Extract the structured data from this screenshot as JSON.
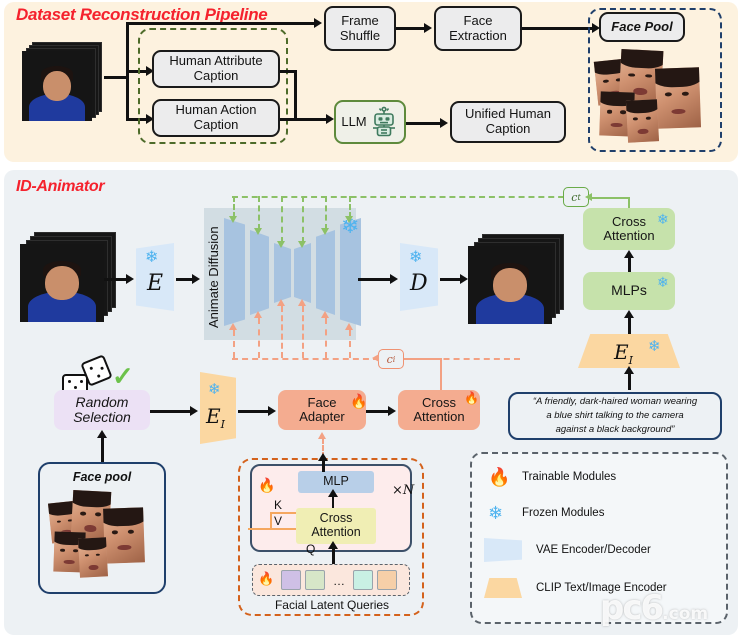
{
  "figure": {
    "panels": [
      {
        "title": "Dataset Reconstruction Pipeline"
      },
      {
        "title": "ID-Animator"
      }
    ]
  },
  "top_panel": {
    "title": "Dataset Reconstruction Pipeline",
    "boxes": {
      "frame_shuffle": "Frame\nShuffle",
      "frame_shuffle_l1": "Frame",
      "frame_shuffle_l2": "Shuffle",
      "face_extraction_l1": "Face",
      "face_extraction_l2": "Extraction",
      "face_pool": "Face Pool",
      "human_attribute_l1": "Human Attribute",
      "human_attribute_l2": "Caption",
      "human_action_l1": "Human Action",
      "human_action_l2": "Caption",
      "llm": "LLM",
      "unified_l1": "Unified Human",
      "unified_l2": "Caption"
    },
    "icons": {
      "llm_robot": "robot-icon"
    }
  },
  "bottom_panel": {
    "title": "ID-Animator",
    "unet_label": "Animate Diffusion",
    "vae_encoder_glyph": "E",
    "vae_decoder_glyph": "D",
    "clip_encoder_glyph": "E",
    "clip_encoder_sub": "I",
    "tags": {
      "c_t": "c",
      "c_t_sub": "t",
      "c_i": "c",
      "c_i_sub": "i"
    },
    "modules": {
      "cross_attention_text_l1": "Cross",
      "cross_attention_text_l2": "Attention",
      "mlps": "MLPs",
      "random_selection_l1": "Random",
      "random_selection_l2": "Selection",
      "face_adapter_l1": "Face",
      "face_adapter_l2": "Adapter",
      "cross_attention_id_l1": "Cross",
      "cross_attention_id_l2": "Attention"
    },
    "prompt": "“A friendly, dark-haired woman wearing a blue shirt talking to the camera against a black background”",
    "prompt_lines": [
      "“A friendly, dark-haired woman wearing",
      "a blue shirt talking to the camera",
      "against a black background”"
    ],
    "face_pool_label": "Face pool",
    "adapter_detail": {
      "mlp": "MLP",
      "cross_attention_l1": "Cross",
      "cross_attention_l2": "Attention",
      "repeat": "×N",
      "k_label": "K",
      "v_label": "V",
      "q_label": "Q",
      "queries_label": "Facial Latent Queries",
      "query_chip_colors": [
        "#cfc0e6",
        "#d7e6c8",
        "#c9f0e4",
        "#f6cfa8"
      ],
      "query_ellipsis": "…"
    }
  },
  "legend": {
    "items": [
      {
        "icon": "flame-icon",
        "label": "Trainable Modules"
      },
      {
        "icon": "snowflake-icon",
        "label": "Frozen Modules"
      },
      {
        "icon": "vae-trapezoid-icon",
        "label": "VAE Encoder/Decoder"
      },
      {
        "icon": "clip-trapezoid-icon",
        "label": "CLIP Text/Image Encoder"
      }
    ]
  },
  "watermark": {
    "text": "pc6",
    "suffix": ".com"
  },
  "colors": {
    "top_panel_bg": "#fdf2df",
    "bottom_panel_bg": "#edf1f4",
    "title_red": "#f5222d",
    "green_module": "#c6e2ab",
    "peach_module": "#f4ac90",
    "lavender_module": "#ece1f5",
    "blue_module": "#b8cfe8",
    "yellow_module": "#f0eeb4",
    "vae_trapezoid": "#d8e8f8",
    "clip_trapezoid": "#fbd7a1",
    "unet_bg": "#d2dde3",
    "unet_block": "#a7c3e0",
    "green_dash": "#6aab49",
    "peach_dash": "#ef9272",
    "navy_dash": "#1f3f6b",
    "orange_dash": "#d4621c"
  }
}
